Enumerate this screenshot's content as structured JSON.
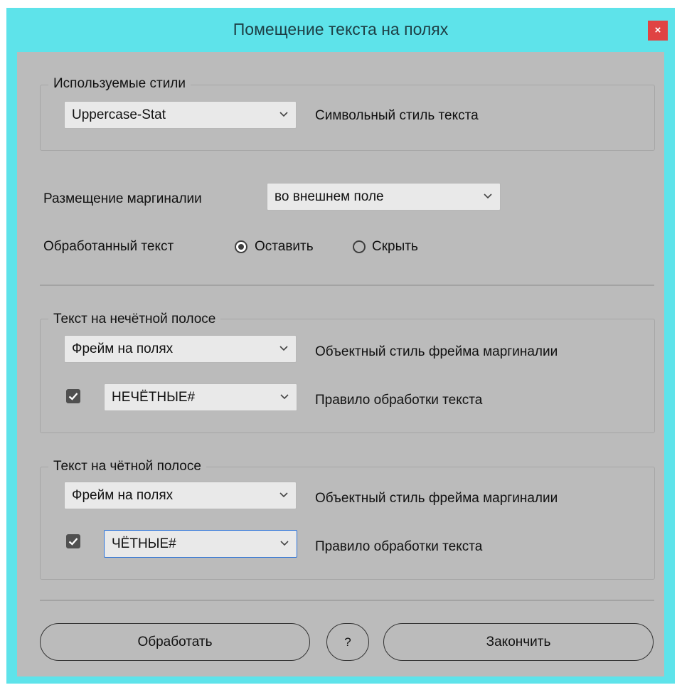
{
  "window": {
    "title": "Помещение текста на полях",
    "close_glyph": "×"
  },
  "styles_group": {
    "legend": "Используемые стили",
    "char_style_value": "Uppercase-Stat",
    "char_style_label": "Символьный стиль текста"
  },
  "placement": {
    "label": "Размещение маргиналии",
    "value": "во внешнем поле"
  },
  "processed": {
    "label": "Обработанный текст",
    "keep": "Оставить",
    "hide": "Скрыть",
    "selected": "keep"
  },
  "odd_group": {
    "legend": "Текст на нечётной полосе",
    "frame_value": "Фрейм на полях",
    "frame_label": "Объектный стиль фрейма маргиналии",
    "checked": true,
    "rule_value": "НЕЧЁТНЫЕ#",
    "rule_label": "Правило обработки текста"
  },
  "even_group": {
    "legend": "Текст на чётной полосе",
    "frame_value": "Фрейм на полях",
    "frame_label": "Объектный стиль фрейма маргиналии",
    "checked": true,
    "rule_value": "ЧЁТНЫЕ#",
    "rule_label": "Правило обработки текста"
  },
  "buttons": {
    "process": "Обработать",
    "help": "?",
    "finish": "Закончить"
  },
  "icons": {
    "dropdown": "chevron-down-icon",
    "check": "checkmark-icon",
    "close": "close-icon"
  },
  "colors": {
    "title_bar": "#5ee3ea",
    "close": "#e04343",
    "client": "#bbbbbb",
    "focus": "#2b72d8"
  }
}
